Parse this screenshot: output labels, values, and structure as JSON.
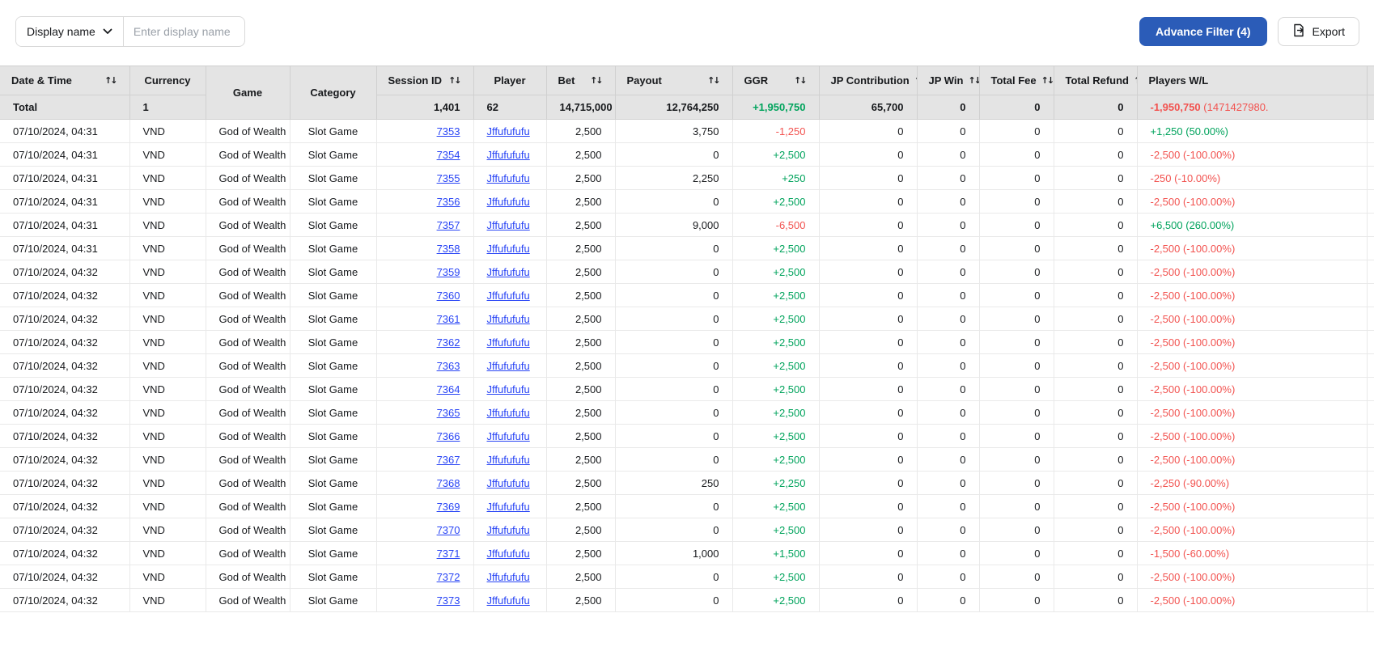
{
  "filter_bar": {
    "field_selector_label": "Display name",
    "search_placeholder": "Enter display name",
    "advance_filter_label": "Advance Filter (4)",
    "export_label": "Export"
  },
  "colors": {
    "accent_blue": "#2b5cb8",
    "link_blue": "#2945f5",
    "positive_green": "#00a35c",
    "negative_red": "#f2524f",
    "header_bg": "#e4e4e4"
  },
  "table": {
    "columns": [
      {
        "key": "datetime",
        "label": "Date & Time",
        "sortable": true,
        "align": "left"
      },
      {
        "key": "currency",
        "label": "Currency",
        "sortable": false,
        "align": "left",
        "header_align": "center"
      },
      {
        "key": "game",
        "label": "Game",
        "sortable": false,
        "align": "center",
        "span": true
      },
      {
        "key": "category",
        "label": "Category",
        "sortable": false,
        "align": "center",
        "span": true
      },
      {
        "key": "session_id",
        "label": "Session ID",
        "sortable": true,
        "align": "right",
        "cell": "link"
      },
      {
        "key": "player",
        "label": "Player",
        "sortable": false,
        "align": "left",
        "header_align": "center",
        "cell": "link"
      },
      {
        "key": "bet",
        "label": "Bet",
        "sortable": true,
        "align": "right"
      },
      {
        "key": "payout",
        "label": "Payout",
        "sortable": true,
        "align": "right"
      },
      {
        "key": "ggr",
        "label": "GGR",
        "sortable": true,
        "align": "right"
      },
      {
        "key": "jp_contribution",
        "label": "JP Contribution",
        "sortable": true,
        "align": "right"
      },
      {
        "key": "jp_win",
        "label": "JP Win",
        "sortable": true,
        "align": "right"
      },
      {
        "key": "total_fee",
        "label": "Total Fee",
        "sortable": true,
        "align": "right"
      },
      {
        "key": "total_refund",
        "label": "Total Refund",
        "sortable": true,
        "align": "right"
      },
      {
        "key": "players_wl",
        "label": "Players W/L",
        "sortable": false,
        "align": "left"
      }
    ],
    "total_row": {
      "label": "Total",
      "currency": "1",
      "session_id": "1,401",
      "player": "62",
      "bet": "14,715,000",
      "payout": "12,764,250",
      "ggr": "+1,950,750",
      "ggr_trend": "positive",
      "jp_contribution": "65,700",
      "jp_win": "0",
      "total_fee": "0",
      "total_refund": "0",
      "players_wl": "-1,950,750",
      "players_wl_extra": "(1471427980.",
      "players_wl_trend": "negative"
    },
    "rows": [
      {
        "datetime": "07/10/2024, 04:31",
        "currency": "VND",
        "game": "God of Wealth",
        "category": "Slot Game",
        "session_id": "7353",
        "player": "Jffufufufu",
        "bet": "2,500",
        "payout": "3,750",
        "ggr": "-1,250",
        "ggr_trend": "negative",
        "jp_contribution": "0",
        "jp_win": "0",
        "total_fee": "0",
        "total_refund": "0",
        "players_wl": "+1,250 (50.00%)",
        "players_wl_trend": "positive"
      },
      {
        "datetime": "07/10/2024, 04:31",
        "currency": "VND",
        "game": "God of Wealth",
        "category": "Slot Game",
        "session_id": "7354",
        "player": "Jffufufufu",
        "bet": "2,500",
        "payout": "0",
        "ggr": "+2,500",
        "ggr_trend": "positive",
        "jp_contribution": "0",
        "jp_win": "0",
        "total_fee": "0",
        "total_refund": "0",
        "players_wl": "-2,500 (-100.00%)",
        "players_wl_trend": "negative"
      },
      {
        "datetime": "07/10/2024, 04:31",
        "currency": "VND",
        "game": "God of Wealth",
        "category": "Slot Game",
        "session_id": "7355",
        "player": "Jffufufufu",
        "bet": "2,500",
        "payout": "2,250",
        "ggr": "+250",
        "ggr_trend": "positive",
        "jp_contribution": "0",
        "jp_win": "0",
        "total_fee": "0",
        "total_refund": "0",
        "players_wl": "-250 (-10.00%)",
        "players_wl_trend": "negative"
      },
      {
        "datetime": "07/10/2024, 04:31",
        "currency": "VND",
        "game": "God of Wealth",
        "category": "Slot Game",
        "session_id": "7356",
        "player": "Jffufufufu",
        "bet": "2,500",
        "payout": "0",
        "ggr": "+2,500",
        "ggr_trend": "positive",
        "jp_contribution": "0",
        "jp_win": "0",
        "total_fee": "0",
        "total_refund": "0",
        "players_wl": "-2,500 (-100.00%)",
        "players_wl_trend": "negative"
      },
      {
        "datetime": "07/10/2024, 04:31",
        "currency": "VND",
        "game": "God of Wealth",
        "category": "Slot Game",
        "session_id": "7357",
        "player": "Jffufufufu",
        "bet": "2,500",
        "payout": "9,000",
        "ggr": "-6,500",
        "ggr_trend": "negative",
        "jp_contribution": "0",
        "jp_win": "0",
        "total_fee": "0",
        "total_refund": "0",
        "players_wl": "+6,500 (260.00%)",
        "players_wl_trend": "positive"
      },
      {
        "datetime": "07/10/2024, 04:31",
        "currency": "VND",
        "game": "God of Wealth",
        "category": "Slot Game",
        "session_id": "7358",
        "player": "Jffufufufu",
        "bet": "2,500",
        "payout": "0",
        "ggr": "+2,500",
        "ggr_trend": "positive",
        "jp_contribution": "0",
        "jp_win": "0",
        "total_fee": "0",
        "total_refund": "0",
        "players_wl": "-2,500 (-100.00%)",
        "players_wl_trend": "negative"
      },
      {
        "datetime": "07/10/2024, 04:32",
        "currency": "VND",
        "game": "God of Wealth",
        "category": "Slot Game",
        "session_id": "7359",
        "player": "Jffufufufu",
        "bet": "2,500",
        "payout": "0",
        "ggr": "+2,500",
        "ggr_trend": "positive",
        "jp_contribution": "0",
        "jp_win": "0",
        "total_fee": "0",
        "total_refund": "0",
        "players_wl": "-2,500 (-100.00%)",
        "players_wl_trend": "negative"
      },
      {
        "datetime": "07/10/2024, 04:32",
        "currency": "VND",
        "game": "God of Wealth",
        "category": "Slot Game",
        "session_id": "7360",
        "player": "Jffufufufu",
        "bet": "2,500",
        "payout": "0",
        "ggr": "+2,500",
        "ggr_trend": "positive",
        "jp_contribution": "0",
        "jp_win": "0",
        "total_fee": "0",
        "total_refund": "0",
        "players_wl": "-2,500 (-100.00%)",
        "players_wl_trend": "negative"
      },
      {
        "datetime": "07/10/2024, 04:32",
        "currency": "VND",
        "game": "God of Wealth",
        "category": "Slot Game",
        "session_id": "7361",
        "player": "Jffufufufu",
        "bet": "2,500",
        "payout": "0",
        "ggr": "+2,500",
        "ggr_trend": "positive",
        "jp_contribution": "0",
        "jp_win": "0",
        "total_fee": "0",
        "total_refund": "0",
        "players_wl": "-2,500 (-100.00%)",
        "players_wl_trend": "negative"
      },
      {
        "datetime": "07/10/2024, 04:32",
        "currency": "VND",
        "game": "God of Wealth",
        "category": "Slot Game",
        "session_id": "7362",
        "player": "Jffufufufu",
        "bet": "2,500",
        "payout": "0",
        "ggr": "+2,500",
        "ggr_trend": "positive",
        "jp_contribution": "0",
        "jp_win": "0",
        "total_fee": "0",
        "total_refund": "0",
        "players_wl": "-2,500 (-100.00%)",
        "players_wl_trend": "negative"
      },
      {
        "datetime": "07/10/2024, 04:32",
        "currency": "VND",
        "game": "God of Wealth",
        "category": "Slot Game",
        "session_id": "7363",
        "player": "Jffufufufu",
        "bet": "2,500",
        "payout": "0",
        "ggr": "+2,500",
        "ggr_trend": "positive",
        "jp_contribution": "0",
        "jp_win": "0",
        "total_fee": "0",
        "total_refund": "0",
        "players_wl": "-2,500 (-100.00%)",
        "players_wl_trend": "negative"
      },
      {
        "datetime": "07/10/2024, 04:32",
        "currency": "VND",
        "game": "God of Wealth",
        "category": "Slot Game",
        "session_id": "7364",
        "player": "Jffufufufu",
        "bet": "2,500",
        "payout": "0",
        "ggr": "+2,500",
        "ggr_trend": "positive",
        "jp_contribution": "0",
        "jp_win": "0",
        "total_fee": "0",
        "total_refund": "0",
        "players_wl": "-2,500 (-100.00%)",
        "players_wl_trend": "negative"
      },
      {
        "datetime": "07/10/2024, 04:32",
        "currency": "VND",
        "game": "God of Wealth",
        "category": "Slot Game",
        "session_id": "7365",
        "player": "Jffufufufu",
        "bet": "2,500",
        "payout": "0",
        "ggr": "+2,500",
        "ggr_trend": "positive",
        "jp_contribution": "0",
        "jp_win": "0",
        "total_fee": "0",
        "total_refund": "0",
        "players_wl": "-2,500 (-100.00%)",
        "players_wl_trend": "negative"
      },
      {
        "datetime": "07/10/2024, 04:32",
        "currency": "VND",
        "game": "God of Wealth",
        "category": "Slot Game",
        "session_id": "7366",
        "player": "Jffufufufu",
        "bet": "2,500",
        "payout": "0",
        "ggr": "+2,500",
        "ggr_trend": "positive",
        "jp_contribution": "0",
        "jp_win": "0",
        "total_fee": "0",
        "total_refund": "0",
        "players_wl": "-2,500 (-100.00%)",
        "players_wl_trend": "negative"
      },
      {
        "datetime": "07/10/2024, 04:32",
        "currency": "VND",
        "game": "God of Wealth",
        "category": "Slot Game",
        "session_id": "7367",
        "player": "Jffufufufu",
        "bet": "2,500",
        "payout": "0",
        "ggr": "+2,500",
        "ggr_trend": "positive",
        "jp_contribution": "0",
        "jp_win": "0",
        "total_fee": "0",
        "total_refund": "0",
        "players_wl": "-2,500 (-100.00%)",
        "players_wl_trend": "negative"
      },
      {
        "datetime": "07/10/2024, 04:32",
        "currency": "VND",
        "game": "God of Wealth",
        "category": "Slot Game",
        "session_id": "7368",
        "player": "Jffufufufu",
        "bet": "2,500",
        "payout": "250",
        "ggr": "+2,250",
        "ggr_trend": "positive",
        "jp_contribution": "0",
        "jp_win": "0",
        "total_fee": "0",
        "total_refund": "0",
        "players_wl": "-2,250 (-90.00%)",
        "players_wl_trend": "negative"
      },
      {
        "datetime": "07/10/2024, 04:32",
        "currency": "VND",
        "game": "God of Wealth",
        "category": "Slot Game",
        "session_id": "7369",
        "player": "Jffufufufu",
        "bet": "2,500",
        "payout": "0",
        "ggr": "+2,500",
        "ggr_trend": "positive",
        "jp_contribution": "0",
        "jp_win": "0",
        "total_fee": "0",
        "total_refund": "0",
        "players_wl": "-2,500 (-100.00%)",
        "players_wl_trend": "negative"
      },
      {
        "datetime": "07/10/2024, 04:32",
        "currency": "VND",
        "game": "God of Wealth",
        "category": "Slot Game",
        "session_id": "7370",
        "player": "Jffufufufu",
        "bet": "2,500",
        "payout": "0",
        "ggr": "+2,500",
        "ggr_trend": "positive",
        "jp_contribution": "0",
        "jp_win": "0",
        "total_fee": "0",
        "total_refund": "0",
        "players_wl": "-2,500 (-100.00%)",
        "players_wl_trend": "negative"
      },
      {
        "datetime": "07/10/2024, 04:32",
        "currency": "VND",
        "game": "God of Wealth",
        "category": "Slot Game",
        "session_id": "7371",
        "player": "Jffufufufu",
        "bet": "2,500",
        "payout": "1,000",
        "ggr": "+1,500",
        "ggr_trend": "positive",
        "jp_contribution": "0",
        "jp_win": "0",
        "total_fee": "0",
        "total_refund": "0",
        "players_wl": "-1,500 (-60.00%)",
        "players_wl_trend": "negative"
      },
      {
        "datetime": "07/10/2024, 04:32",
        "currency": "VND",
        "game": "God of Wealth",
        "category": "Slot Game",
        "session_id": "7372",
        "player": "Jffufufufu",
        "bet": "2,500",
        "payout": "0",
        "ggr": "+2,500",
        "ggr_trend": "positive",
        "jp_contribution": "0",
        "jp_win": "0",
        "total_fee": "0",
        "total_refund": "0",
        "players_wl": "-2,500 (-100.00%)",
        "players_wl_trend": "negative"
      },
      {
        "datetime": "07/10/2024, 04:32",
        "currency": "VND",
        "game": "God of Wealth",
        "category": "Slot Game",
        "session_id": "7373",
        "player": "Jffufufufu",
        "bet": "2,500",
        "payout": "0",
        "ggr": "+2,500",
        "ggr_trend": "positive",
        "jp_contribution": "0",
        "jp_win": "0",
        "total_fee": "0",
        "total_refund": "0",
        "players_wl": "-2,500 (-100.00%)",
        "players_wl_trend": "negative"
      }
    ]
  }
}
